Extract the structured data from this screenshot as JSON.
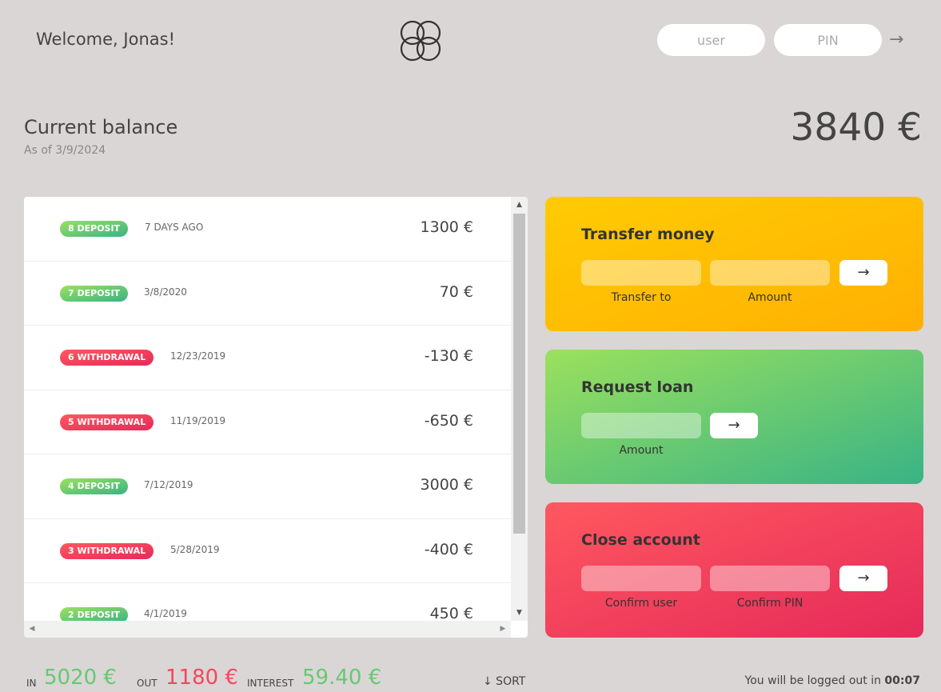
{
  "nav": {
    "welcome": "Welcome, Jonas!",
    "user_placeholder": "user",
    "pin_placeholder": "PIN",
    "login_arrow": "→"
  },
  "balance": {
    "label": "Current balance",
    "date": "As of 3/9/2024",
    "value": "3840 €"
  },
  "movements": [
    {
      "type": "deposit",
      "label": "8 DEPOSIT",
      "date": "7 DAYS AGO",
      "value": "1300 €"
    },
    {
      "type": "deposit",
      "label": "7 DEPOSIT",
      "date": "3/8/2020",
      "value": "70 €"
    },
    {
      "type": "withdrawal",
      "label": "6 WITHDRAWAL",
      "date": "12/23/2019",
      "value": "-130 €"
    },
    {
      "type": "withdrawal",
      "label": "5 WITHDRAWAL",
      "date": "11/19/2019",
      "value": "-650 €"
    },
    {
      "type": "deposit",
      "label": "4 DEPOSIT",
      "date": "7/12/2019",
      "value": "3000 €"
    },
    {
      "type": "withdrawal",
      "label": "3 WITHDRAWAL",
      "date": "5/28/2019",
      "value": "-400 €"
    },
    {
      "type": "deposit",
      "label": "2 DEPOSIT",
      "date": "4/1/2019",
      "value": "450 €"
    }
  ],
  "operations": {
    "transfer": {
      "title": "Transfer money",
      "field1_label": "Transfer to",
      "field2_label": "Amount",
      "button": "→"
    },
    "loan": {
      "title": "Request loan",
      "field1_label": "Amount",
      "button": "→"
    },
    "close": {
      "title": "Close account",
      "field1_label": "Confirm user",
      "field2_label": "Confirm PIN",
      "button": "→"
    }
  },
  "summary": {
    "in_label": "In",
    "in_value": "5020 €",
    "out_label": "Out",
    "out_value": "1180 €",
    "interest_label": "Interest",
    "interest_value": "59.40 €",
    "sort_label": "↓ SORT"
  },
  "timer": {
    "text": "You will be logged out in ",
    "time": "00:07"
  },
  "colors": {
    "background": "#dad6d5",
    "deposit": "#66c873",
    "withdrawal": "#f5465d",
    "transfer": "#ffb003",
    "loan": "#39b385",
    "close": "#e52a5a"
  }
}
